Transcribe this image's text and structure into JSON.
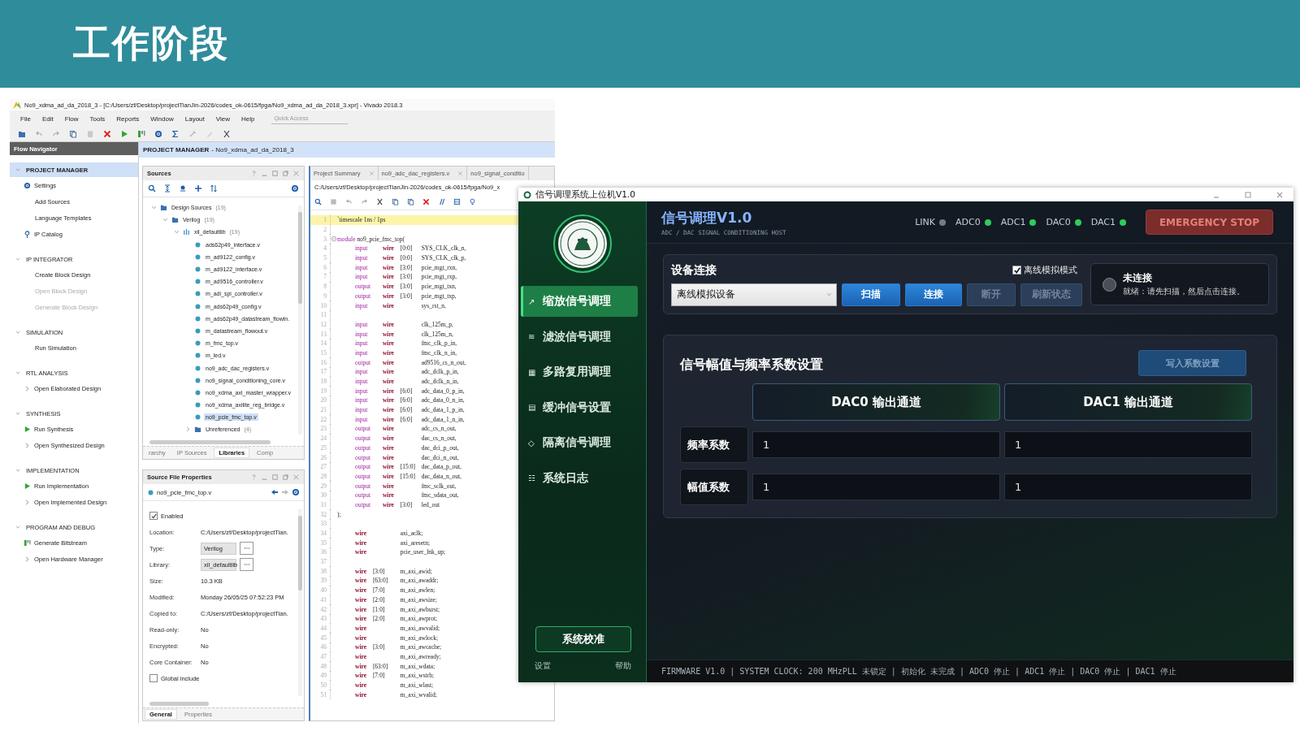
{
  "slide": {
    "title": "工作阶段"
  },
  "vivado": {
    "title": "No9_xdma_ad_da_2018_3 - [C:/Users/zf/Desktop/projectTianJin-2026/codes_ok-0615/fpga/No9_xdma_ad_da_2018_3.xpr] - Vivado 2018.3",
    "menu": [
      "File",
      "Edit",
      "Flow",
      "Tools",
      "Reports",
      "Window",
      "Layout",
      "View",
      "Help"
    ],
    "quick_access": {
      "placeholder": "Quick Access"
    },
    "flow_navigator": {
      "title": "Flow Navigator",
      "sections": [
        {
          "title": "PROJECT MANAGER",
          "selected": true,
          "items": [
            {
              "label": "Settings",
              "kind": "settings",
              "disabled": false
            },
            {
              "label": "Add Sources",
              "kind": "plain",
              "disabled": false
            },
            {
              "label": "Language Templates",
              "kind": "plain",
              "disabled": false
            },
            {
              "label": "IP Catalog",
              "kind": "catalog",
              "disabled": false
            }
          ]
        },
        {
          "title": "IP INTEGRATOR",
          "selected": false,
          "items": [
            {
              "label": "Create Block Design",
              "kind": "plain",
              "disabled": false
            },
            {
              "label": "Open Block Design",
              "kind": "plain",
              "disabled": true
            },
            {
              "label": "Generate Block Design",
              "kind": "plain",
              "disabled": true
            }
          ]
        },
        {
          "title": "SIMULATION",
          "selected": false,
          "items": [
            {
              "label": "Run Simulation",
              "kind": "plain",
              "disabled": false
            }
          ]
        },
        {
          "title": "RTL ANALYSIS",
          "selected": false,
          "items": [
            {
              "label": "Open Elaborated Design",
              "kind": "open",
              "disabled": false
            }
          ]
        },
        {
          "title": "SYNTHESIS",
          "selected": false,
          "items": [
            {
              "label": "Run Synthesis",
              "kind": "run",
              "disabled": false
            },
            {
              "label": "Open Synthesized Design",
              "kind": "open",
              "disabled": false
            }
          ]
        },
        {
          "title": "IMPLEMENTATION",
          "selected": false,
          "items": [
            {
              "label": "Run Implementation",
              "kind": "run",
              "disabled": false
            },
            {
              "label": "Open Implemented Design",
              "kind": "open",
              "disabled": false
            }
          ]
        },
        {
          "title": "PROGRAM AND DEBUG",
          "selected": false,
          "items": [
            {
              "label": "Generate Bitstream",
              "kind": "bitstream",
              "disabled": false
            },
            {
              "label": "Open Hardware Manager",
              "kind": "open",
              "disabled": false
            }
          ]
        }
      ]
    },
    "project_bar": {
      "title": "PROJECT MANAGER",
      "project": "- No9_xdma_ad_da_2018_3"
    },
    "sources": {
      "title": "Sources",
      "tree": [
        {
          "label": "Design Sources",
          "count": "(19)",
          "kind": "folder",
          "expanded": true,
          "children": [
            {
              "label": "Verilog",
              "count": "(19)",
              "kind": "folder",
              "expanded": true,
              "children": [
                {
                  "label": "xil_defaultlib",
                  "count": "(19)",
                  "kind": "library",
                  "expanded": true,
                  "children": [
                    {
                      "label": "ads62p49_interface.v",
                      "kind": "file",
                      "selected": false
                    },
                    {
                      "label": "m_ad9122_config.v",
                      "kind": "file",
                      "selected": false
                    },
                    {
                      "label": "m_ad9122_interface.v",
                      "kind": "file",
                      "selected": false
                    },
                    {
                      "label": "m_ad9516_controller.v",
                      "kind": "file",
                      "selected": false
                    },
                    {
                      "label": "m_adi_spi_controller.v",
                      "kind": "file",
                      "selected": false
                    },
                    {
                      "label": "m_ads62p49_config.v",
                      "kind": "file",
                      "selected": false
                    },
                    {
                      "label": "m_ads62p49_datastream_flowin.",
                      "kind": "file",
                      "selected": false
                    },
                    {
                      "label": "m_datastream_flowout.v",
                      "kind": "file",
                      "selected": false
                    },
                    {
                      "label": "m_fmc_top.v",
                      "kind": "file",
                      "selected": false
                    },
                    {
                      "label": "m_led.v",
                      "kind": "file",
                      "selected": false
                    },
                    {
                      "label": "no9_adc_dac_registers.v",
                      "kind": "file",
                      "selected": false
                    },
                    {
                      "label": "no9_signal_conditioning_core.v",
                      "kind": "file",
                      "selected": false
                    },
                    {
                      "label": "no9_xdma_axi_master_wrapper.v",
                      "kind": "file",
                      "selected": false
                    },
                    {
                      "label": "no9_xdma_axilite_reg_bridge.v",
                      "kind": "file",
                      "selected": false
                    },
                    {
                      "label": "no9_pcie_fmc_top.v",
                      "kind": "file",
                      "selected": true
                    },
                    {
                      "label": "Unreferenced",
                      "count": "(4)",
                      "kind": "folder",
                      "expanded": false
                    }
                  ]
                }
              ]
            }
          ]
        }
      ],
      "tabs": [
        {
          "label": "rarchy",
          "selected": false
        },
        {
          "label": "IP Sources",
          "selected": false
        },
        {
          "label": "Libraries",
          "selected": true
        },
        {
          "label": "Comp",
          "selected": false
        }
      ]
    },
    "properties": {
      "title": "Source File Properties",
      "file": "no9_pcie_fmc_top.v",
      "enabled": {
        "label": "Enabled",
        "checked": true
      },
      "fields": [
        {
          "label": "Location:",
          "value": "C:/Users/zf/Desktop/projectTian.",
          "kind": "text"
        },
        {
          "label": "Type:",
          "value": "Verilog",
          "kind": "select"
        },
        {
          "label": "Library:",
          "value": "xil_defaultlib",
          "kind": "select"
        },
        {
          "label": "Size:",
          "value": "10.3 KB",
          "kind": "text"
        },
        {
          "label": "Modified:",
          "value": "Monday 26/05/25 07:52:23 PM",
          "kind": "text"
        },
        {
          "label": "Copied to:",
          "value": "C:/Users/zf/Desktop/projectTian.",
          "kind": "text"
        },
        {
          "label": "Read-only:",
          "value": "No",
          "kind": "text"
        },
        {
          "label": "Encrypted:",
          "value": "No",
          "kind": "text"
        },
        {
          "label": "Core Container:",
          "value": "No",
          "kind": "text"
        }
      ],
      "global_include": {
        "label": "Global include",
        "checked": false
      },
      "tabs": [
        {
          "label": "General",
          "selected": true
        },
        {
          "label": "Properties",
          "selected": false
        }
      ]
    },
    "editor": {
      "tabs": [
        {
          "label": "Project Summary",
          "closable": true
        },
        {
          "label": "no9_adc_dac_registers.v",
          "closable": true
        },
        {
          "label": "no9_signal_conditio",
          "closable": false
        }
      ],
      "path": "C:/Users/zf/Desktop/projectTianJin-2026/codes_ok-0615/fpga/No9_x",
      "lines": [
        {
          "n": "1",
          "kind": "plain",
          "text": "`timescale 1ns / 1ps",
          "current": true
        },
        {
          "n": "2",
          "kind": "blank",
          "current": false
        },
        {
          "n": "3",
          "kind": "module",
          "keyword": "module",
          "text": "no9_pcie_fmc_top(",
          "current": false
        },
        {
          "n": "4",
          "kind": "port",
          "dir": "input",
          "type": "wire",
          "range": "[0:0]",
          "name": "SYS_CLK_clk_n,",
          "current": false
        },
        {
          "n": "5",
          "kind": "port",
          "dir": "input",
          "type": "wire",
          "range": "[0:0]",
          "name": "SYS_CLK_clk_p,",
          "current": false
        },
        {
          "n": "6",
          "kind": "port",
          "dir": "input",
          "type": "wire",
          "range": "[3:0]",
          "name": "pcie_mgt_rxn,",
          "current": false
        },
        {
          "n": "7",
          "kind": "port",
          "dir": "input",
          "type": "wire",
          "range": "[3:0]",
          "name": "pcie_mgt_rxp,",
          "current": false
        },
        {
          "n": "8",
          "kind": "port",
          "dir": "output",
          "type": "wire",
          "range": "[3:0]",
          "name": "pcie_mgt_txn,",
          "current": false
        },
        {
          "n": "9",
          "kind": "port",
          "dir": "output",
          "type": "wire",
          "range": "[3:0]",
          "name": "pcie_mgt_txp,",
          "current": false
        },
        {
          "n": "10",
          "kind": "port",
          "dir": "input",
          "type": "wire",
          "name": "sys_rst_n,",
          "current": false
        },
        {
          "n": "11",
          "kind": "blank",
          "current": false
        },
        {
          "n": "12",
          "kind": "port",
          "dir": "input",
          "type": "wire",
          "name": "clk_125m_p,",
          "current": false
        },
        {
          "n": "13",
          "kind": "port",
          "dir": "input",
          "type": "wire",
          "name": "clk_125m_n,",
          "current": false
        },
        {
          "n": "14",
          "kind": "port",
          "dir": "input",
          "type": "wire",
          "name": "fmc_clk_p_in,",
          "current": false
        },
        {
          "n": "15",
          "kind": "port",
          "dir": "input",
          "type": "wire",
          "name": "fmc_clk_n_in,",
          "current": false
        },
        {
          "n": "16",
          "kind": "port",
          "dir": "output",
          "type": "wire",
          "name": "ad9516_cs_n_out,",
          "current": false
        },
        {
          "n": "17",
          "kind": "port",
          "dir": "input",
          "type": "wire",
          "name": "adc_dclk_p_in,",
          "current": false
        },
        {
          "n": "18",
          "kind": "port",
          "dir": "input",
          "type": "wire",
          "name": "adc_dclk_n_in,",
          "current": false
        },
        {
          "n": "19",
          "kind": "port",
          "dir": "input",
          "type": "wire",
          "range": "[6:0]",
          "name": "adc_data_0_p_in,",
          "current": false
        },
        {
          "n": "20",
          "kind": "port",
          "dir": "input",
          "type": "wire",
          "range": "[6:0]",
          "name": "adc_data_0_n_in,",
          "current": false
        },
        {
          "n": "21",
          "kind": "port",
          "dir": "input",
          "type": "wire",
          "range": "[6:0]",
          "name": "adc_data_1_p_in,",
          "current": false
        },
        {
          "n": "22",
          "kind": "port",
          "dir": "input",
          "type": "wire",
          "range": "[6:0]",
          "name": "adc_data_1_n_in,",
          "current": false
        },
        {
          "n": "23",
          "kind": "port",
          "dir": "output",
          "type": "wire",
          "name": "adc_cs_n_out,",
          "current": false
        },
        {
          "n": "24",
          "kind": "port",
          "dir": "output",
          "type": "wire",
          "name": "dac_cs_n_out,",
          "current": false
        },
        {
          "n": "25",
          "kind": "port",
          "dir": "output",
          "type": "wire",
          "name": "dac_dci_p_out,",
          "current": false
        },
        {
          "n": "26",
          "kind": "port",
          "dir": "output",
          "type": "wire",
          "name": "dac_dci_n_out,",
          "current": false
        },
        {
          "n": "27",
          "kind": "port",
          "dir": "output",
          "type": "wire",
          "range": "[15:0]",
          "name": "dac_data_p_out,",
          "current": false
        },
        {
          "n": "28",
          "kind": "port",
          "dir": "output",
          "type": "wire",
          "range": "[15:0]",
          "name": "dac_data_n_out,",
          "current": false
        },
        {
          "n": "29",
          "kind": "port",
          "dir": "output",
          "type": "wire",
          "name": "fmc_sclk_out,",
          "current": false
        },
        {
          "n": "30",
          "kind": "port",
          "dir": "output",
          "type": "wire",
          "name": "fmc_sdata_out,",
          "current": false
        },
        {
          "n": "31",
          "kind": "port",
          "dir": "output",
          "type": "wire",
          "range": "[3:0]",
          "name": "led_out",
          "current": false
        },
        {
          "n": "32",
          "kind": "plain",
          "text": ");",
          "current": false
        },
        {
          "n": "33",
          "kind": "blank",
          "current": false
        },
        {
          "n": "34",
          "kind": "decl",
          "type": "wire",
          "name": "axi_aclk;",
          "current": false
        },
        {
          "n": "35",
          "kind": "decl",
          "type": "wire",
          "name": "axi_aresetn;",
          "current": false
        },
        {
          "n": "36",
          "kind": "decl",
          "type": "wire",
          "name": "pcie_user_lnk_up;",
          "current": false
        },
        {
          "n": "37",
          "kind": "blank",
          "current": false
        },
        {
          "n": "38",
          "kind": "decl",
          "type": "wire",
          "range": "[3:0]",
          "name": "m_axi_awid;",
          "current": false
        },
        {
          "n": "39",
          "kind": "decl",
          "type": "wire",
          "range": "[63:0]",
          "name": "m_axi_awaddr;",
          "current": false
        },
        {
          "n": "40",
          "kind": "decl",
          "type": "wire",
          "range": "[7:0]",
          "name": "m_axi_awlen;",
          "current": false
        },
        {
          "n": "41",
          "kind": "decl",
          "type": "wire",
          "range": "[2:0]",
          "name": "m_axi_awsize;",
          "current": false
        },
        {
          "n": "42",
          "kind": "decl",
          "type": "wire",
          "range": "[1:0]",
          "name": "m_axi_awburst;",
          "current": false
        },
        {
          "n": "43",
          "kind": "decl",
          "type": "wire",
          "range": "[2:0]",
          "name": "m_axi_awprot;",
          "current": false
        },
        {
          "n": "44",
          "kind": "decl",
          "type": "wire",
          "name": "m_axi_awvalid;",
          "current": false
        },
        {
          "n": "45",
          "kind": "decl",
          "type": "wire",
          "name": "m_axi_awlock;",
          "current": false
        },
        {
          "n": "46",
          "kind": "decl",
          "type": "wire",
          "range": "[3:0]",
          "name": "m_axi_awcache;",
          "current": false
        },
        {
          "n": "47",
          "kind": "decl",
          "type": "wire",
          "name": "m_axi_awready;",
          "current": false
        },
        {
          "n": "48",
          "kind": "decl",
          "type": "wire",
          "range": "[63:0]",
          "name": "m_axi_wdata;",
          "current": false
        },
        {
          "n": "49",
          "kind": "decl",
          "type": "wire",
          "range": "[7:0]",
          "name": "m_axi_wstrb;",
          "current": false
        },
        {
          "n": "50",
          "kind": "decl",
          "type": "wire",
          "name": "m_axi_wlast;",
          "current": false
        },
        {
          "n": "51",
          "kind": "decl",
          "type": "wire",
          "name": "m_axi_wvalid;",
          "current": false
        }
      ]
    }
  },
  "app": {
    "title": "信号调理系统上位机V1.0",
    "sidebar": {
      "nav": [
        {
          "icon": "↗",
          "label": "缩放信号调理",
          "selected": true
        },
        {
          "icon": "≋",
          "label": "滤波信号调理",
          "selected": false
        },
        {
          "icon": "▦",
          "label": "多路复用调理",
          "selected": false
        },
        {
          "icon": "▤",
          "label": "缓冲信号设置",
          "selected": false
        },
        {
          "icon": "◇",
          "label": "隔离信号调理",
          "selected": false
        },
        {
          "icon": "☷",
          "label": "系统日志",
          "selected": false
        }
      ],
      "calibrate_button": "系统校准",
      "footer_links": [
        "设置",
        "帮助"
      ]
    },
    "header": {
      "title": "信号调理V1.0",
      "subtitle": "ADC / DAC SIGNAL CONDITIONING HOST",
      "indicators": [
        {
          "label": "LINK",
          "on": false
        },
        {
          "label": "ADC0",
          "on": true
        },
        {
          "label": "ADC1",
          "on": true
        },
        {
          "label": "DAC0",
          "on": true
        },
        {
          "label": "DAC1",
          "on": true
        }
      ],
      "emergency_button": "EMERGENCY STOP"
    },
    "connection": {
      "title": "设备连接",
      "offline_mode": {
        "label": "离线模拟模式",
        "checked": true
      },
      "device_select": {
        "value": "离线模拟设备"
      },
      "buttons": [
        {
          "label": "扫描",
          "disabled": false
        },
        {
          "label": "连接",
          "disabled": false
        },
        {
          "label": "断开",
          "disabled": true
        },
        {
          "label": "刷新状态",
          "disabled": true
        }
      ],
      "status": {
        "connected": false,
        "title": "未连接",
        "message": "就绪：请先扫描，然后点击连接。"
      }
    },
    "coefficients": {
      "title": "信号幅值与频率系数设置",
      "write_button": {
        "label": "写入系数设置",
        "disabled": true
      },
      "columns": [
        "DAC0 输出通道",
        "DAC1 输出通道"
      ],
      "rows": [
        {
          "label": "频率系数",
          "values": [
            "1",
            "1"
          ]
        },
        {
          "label": "幅值系数",
          "values": [
            "1",
            "1"
          ]
        }
      ]
    },
    "status_bar": "FIRMWARE V1.0 | SYSTEM CLOCK: 200 MHzPLL 未锁定 | 初始化 未完成 | ADC0 停止 | ADC1 停止 | DAC0 停止 | DAC1 停止"
  }
}
